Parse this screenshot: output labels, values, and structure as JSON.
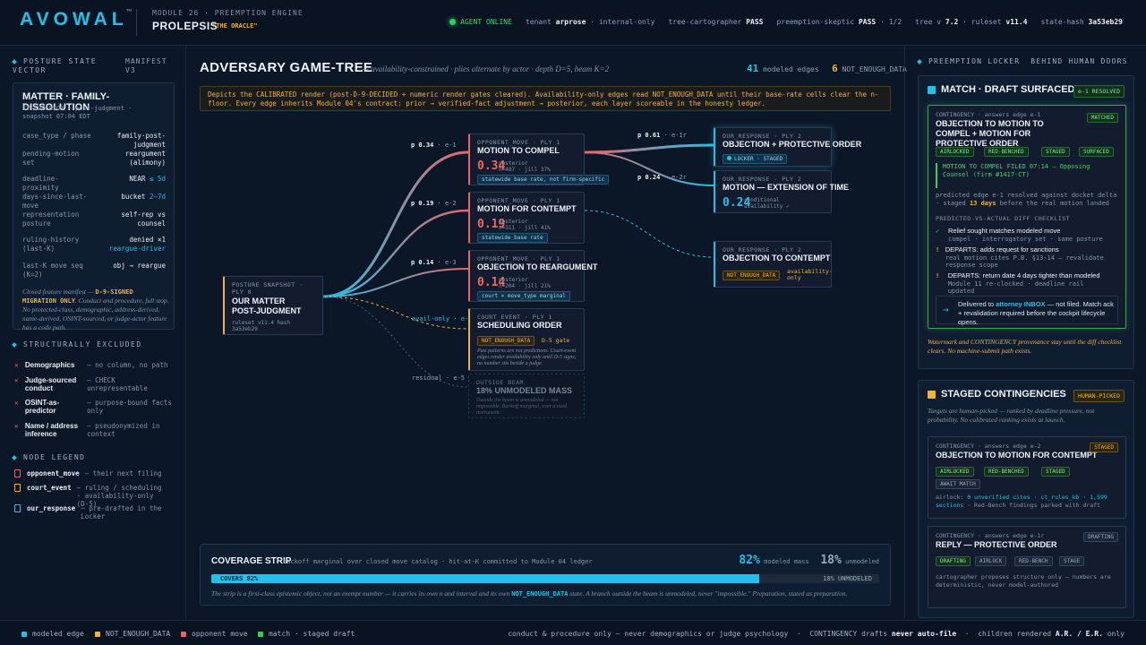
{
  "header": {
    "logo": "AVOWAL",
    "tm": "™",
    "module": "MODULE 26 · PREEMPTION ENGINE",
    "product": "PROLEPSIS",
    "tagline": "\"THE ORACLE\"",
    "agent": "AGENT ONLINE",
    "tenant_label": "tenant",
    "tenant": "arprose",
    "scope": "· internal-only",
    "tree_label": "tree-cartographer",
    "tree_status": "PASS",
    "skeptic_label": "preemption-skeptic",
    "skeptic_status": "PASS",
    "skeptic_count": "· 1/2",
    "treev_label": "tree v",
    "treev": "7.2",
    "ruleset_label": "· ruleset",
    "ruleset": "v11.4",
    "hash_label": "state-hash",
    "hash": "3a53eb29"
  },
  "left": {
    "posture_title": "POSTURE STATE VECTOR",
    "manifest": "MANIFEST V3",
    "matter_title": "MATTER · FAMILY-DISSOLUTION",
    "matter_sub": "CT SUPERIOR · post-judgment · snapshot 07:04 EDT",
    "kv": [
      {
        "k": "case_type / phase",
        "v": "family·post-judgment"
      },
      {
        "k": "pending-motion set",
        "v": "reargument (alimony)"
      },
      {
        "k": "deadline-proximity",
        "v": "NEAR",
        "c": "≤ 5d"
      },
      {
        "k": "days-since-last-move",
        "v": "bucket",
        "c": "2–7d"
      },
      {
        "k": "representation posture",
        "v": "self-rep vs counsel"
      },
      {
        "k": "ruling-history (last-K)",
        "v": "denied ×1",
        "c": "reargue-driver"
      },
      {
        "k": "last-K move seq (K=2)",
        "v": "obj → reargue"
      }
    ],
    "closed_a": "Closed feature manifest — ",
    "closed_b": "D-9-SIGNED MIGRATION ONLY",
    "closed_c": ". Conduct and procedure, full stop. No protected-class, demographic, address-derived, name-derived, OSINT-sourced, or judge-actor feature has a code path.",
    "excluded_title": "STRUCTURALLY EXCLUDED",
    "excluded": [
      {
        "n": "Demographics",
        "d": "— no column, no path"
      },
      {
        "n": "Judge-sourced conduct",
        "d": "— CHECK unrepresentable"
      },
      {
        "n": "OSINT-as-predictor",
        "d": "— purpose-bound facts only"
      },
      {
        "n": "Name / address inference",
        "d": "— pseudonymized in context"
      }
    ],
    "legend_title": "NODE LEGEND",
    "legend": [
      {
        "n": "opponent_move",
        "d": "— their next filing",
        "color": "#e8666a"
      },
      {
        "n": "court_event",
        "d": "— ruling / scheduling · availability-only (D-5)",
        "color": "#f2b13c"
      },
      {
        "n": "our_response",
        "d": "— pre-drafted in the Locker",
        "color": "#22c1e8"
      }
    ]
  },
  "center": {
    "title": "ADVERSARY GAME-TREE",
    "subtitle": "— availability-constrained · plies alternate by actor · depth D=5, beam K=2",
    "modeled_count": "41",
    "modeled_label": "modeled edges",
    "ned_count": "6",
    "ned_label": "NOT_ENOUGH_DATA",
    "note": "Depicts the CALIBRATED render (post-D-9-DECIDED + numeric render gates cleared). Availability-only edges read NOT_ENOUGH_DATA until their base-rate cells clear the n-floor. Every edge inherits Module 04's contract: prior → verified-fact adjustment → posterior, each layer scoreable in the honesty ledger.",
    "root": {
      "h": "POSTURE SNAPSHOT · PLY 0",
      "t": "OUR MATTER POST-JUDGMENT",
      "d": "ruleset v11.4 hash 3a53eb29"
    },
    "edges": [
      {
        "p": "p 0.34",
        "id": "· e-1"
      },
      {
        "p": "p 0.19",
        "id": "· e-2"
      },
      {
        "p": "p 0.14",
        "id": "· e-3"
      },
      {
        "p": "avail-only",
        "id": "· e-4"
      },
      {
        "p": "residual",
        "id": "· e-5"
      },
      {
        "p": "p 0.61",
        "id": "· e-1r"
      },
      {
        "p": "p 0.24",
        "id": "· e-2r"
      }
    ],
    "n1": {
      "h": "OPPONENT_MOVE · PLY 1",
      "t": "MOTION TO COMPEL",
      "p": "0.34",
      "d1": "posterior",
      "d2": "n=487 · jill 37%",
      "chip": "statewide base rate, not firm-specific"
    },
    "n2": {
      "h": "OPPONENT_MOVE · PLY 1",
      "t": "MOTION FOR CONTEMPT",
      "p": "0.19",
      "d1": "posterior",
      "d2": "n=311 · jill 41%",
      "chip": "statewide base rate"
    },
    "n3": {
      "h": "OPPONENT_MOVE · PLY 1",
      "t": "OBJECTION TO REARGUMENT",
      "p": "0.14",
      "d1": "posterior",
      "d2": "n=204 · jill 21%",
      "chip": "court × move_type marginal"
    },
    "n4": {
      "h": "COURT_EVENT · PLY 1",
      "t": "SCHEDULING ORDER",
      "chip": "NOT_ENOUGH_DATA",
      "gate": "D-5 gate",
      "note": "Past patterns are not predictions. Court-event edges render availability only until D-5 signs; no number sits beside a judge."
    },
    "n5": {
      "h": "OUTSIDE BEAM",
      "t": "18% UNMODELED MASS",
      "note": "Outside the beam is unmodeled — not impossible. Backoff marginal, over a used instrument."
    },
    "r1": {
      "h": "OUR_RESPONSE · PLY 2",
      "t": "OBJECTION + PROTECTIVE ORDER",
      "chip": "LOCKER · STAGED"
    },
    "r2": {
      "h": "OUR_RESPONSE · PLY 2",
      "t": "MOTION — EXTENSION OF TIME",
      "p": "0.24",
      "d1": "conditional",
      "d2": "availability ✓"
    },
    "r3": {
      "h": "OUR_RESPONSE · PLY 2",
      "t": "OBJECTION TO CONTEMPT",
      "chip": "NOT_ENOUGH_DATA",
      "avail": "availability-only"
    },
    "coverage": {
      "title": "COVERAGE STRIP",
      "sub": "backoff marginal over closed move catalog · hit-at-K committed to Module 04 ledger",
      "mod": "82%",
      "mod_label": "modeled mass",
      "unmod": "18%",
      "unmod_label": "unmodeled",
      "fill": 0.82,
      "left_label": "COVERS 82%",
      "right_label": "18% UNMODELED",
      "note_a": "The strip is a first-class epistemic object, not an exempt number — it carries its own n and interval and its own ",
      "note_b": "NOT_ENOUGH_DATA",
      "note_c": " state. A branch outside the beam is unmodeled, never \"impossible.\" Preparation, stated as preparation."
    }
  },
  "right": {
    "title": "PREEMPTION LOCKER  BEHIND HUMAN DOORS",
    "match_title": "MATCH · DRAFT SURFACED",
    "match_badge": "e-1 RESOLVED",
    "match_card": {
      "h": "CONTINGENCY · answers edge e-1",
      "t": "OBJECTION TO MOTION TO COMPEL + MOTION FOR PROTECTIVE ORDER",
      "badge": "MATCHED",
      "chips": [
        "AIRLOCKED",
        "RED-BENCHED",
        "STAGED",
        "SURFACED"
      ]
    },
    "filed": "MOTION TO COMPEL FILED 07:14 — Opposing Counsel (firm #1417-CT)",
    "filed_note_a": "predicted edge e-1 resolved against docket delta · staged ",
    "filed_days": "13 days",
    "filed_note_b": " before the real motion landed",
    "diff_title": "PREDICTED-VS-ACTUAL DIFF CHECKLIST",
    "checks": [
      {
        "i": "✓",
        "t": "Relief sought matches modeled move",
        "d": "compel · interrogatory set · same posture",
        "c": "#3ed76a"
      },
      {
        "i": "!",
        "t": "DEPARTS: adds request for sanctions",
        "d": "real motion cites P.B. §13-14 — revalidate response scope",
        "c": "#f2b13c"
      },
      {
        "i": "!",
        "t": "DEPARTS: return date 4 days tighter than modeled",
        "d": "Module 11 re-clocked · deadline rail updated",
        "c": "#f2b13c"
      }
    ],
    "deliver_a": "Delivered to ",
    "deliver_b": "attorney INBOX",
    "deliver_c": " — not filed. Match ack + revalidation required before the cockpit lifecycle opens.",
    "watermark": "Watermark and CONTINGENCY provenance stay until the diff checklist clears. No machine-submit path exists.",
    "staged_title": "STAGED CONTINGENCIES",
    "staged_badge": "HUMAN-PICKED",
    "staged_note": "Targets are human-picked — ranked by deadline pressure, not probability. No calibrated ranking exists at launch.",
    "s1": {
      "h": "CONTINGENCY · answers edge e-2",
      "t": "OBJECTION TO MOTION FOR CONTEMPT",
      "badge": "STAGED",
      "chips": [
        "AIRLOCKED",
        "RED-BENCHED",
        "STAGED",
        "AWAIT MATCH"
      ],
      "note_a": "airlock: ",
      "note_b": "0 unverified cites · ct_rules_kb · 1,599 sections",
      "note_c": " · Red-Bench findings parked with draft"
    },
    "s2": {
      "h": "CONTINGENCY · answers edge e-1r",
      "t": "REPLY — PROTECTIVE ORDER",
      "badge": "DRAFTING",
      "chips": [
        "DRAFTING",
        "AIRLOCK",
        "RED-BENCH",
        "STAGE"
      ],
      "note": "cartographer proposes structure only — numbers are deterministic, never model-authored"
    }
  },
  "footer": {
    "l1": "modeled edge",
    "l2": "NOT_ENOUGH_DATA",
    "l3": "opponent move",
    "l4": "match · staged draft",
    "r_a": "conduct & procedure only — never demographics or judge psychology  ·  CONTINGENCY drafts ",
    "r_b": "never auto-file",
    "r_c": "  ·  children rendered ",
    "r_d": "A.R. / E.R.",
    "r_e": " only"
  }
}
